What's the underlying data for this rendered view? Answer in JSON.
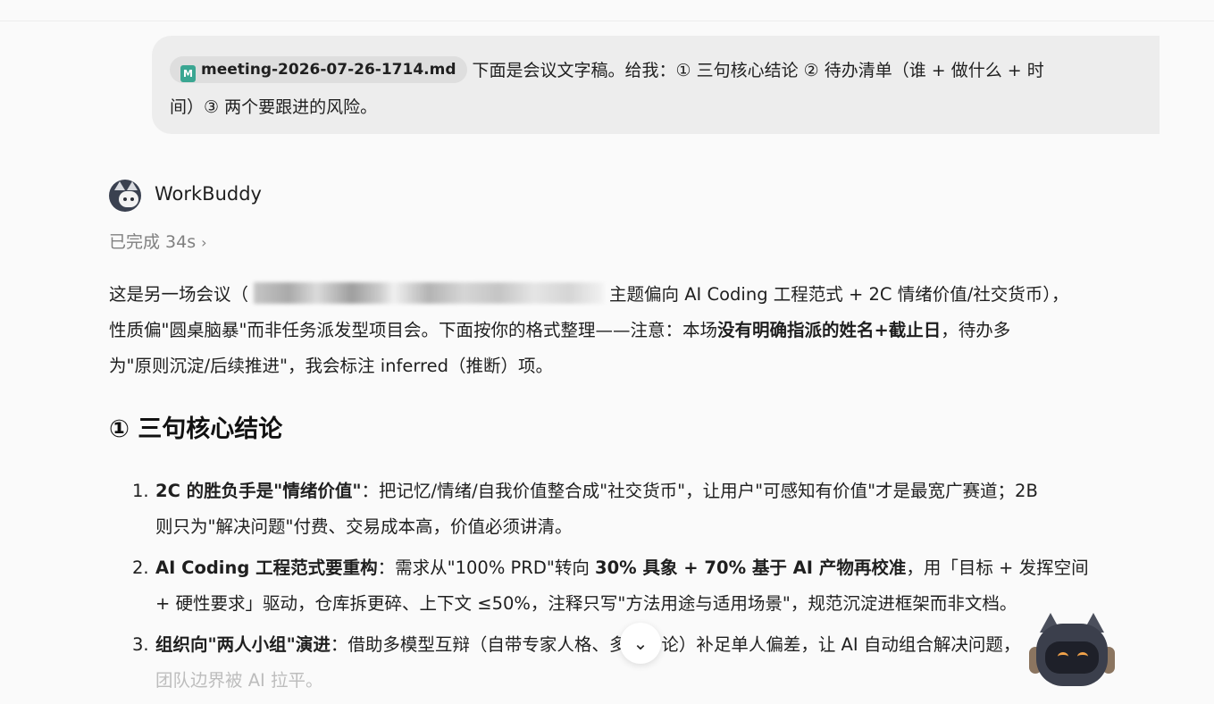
{
  "user_message": {
    "attachment_name": "meeting-2026-07-26-1714.md",
    "attachment_icon": "markdown-file-icon",
    "line1": "下面是会议文字稿。给我：① 三句核心结论 ② 待办清单（谁 + 做什么 + 时",
    "line2": "间）③ 两个要跟进的风险。"
  },
  "agent": {
    "name": "WorkBuddy",
    "status": "已完成 34s"
  },
  "intro": {
    "r1_a": "这是另一场会议（",
    "r1_b": "主题偏向 AI Coding 工程范式 + 2C 情绪价值/社交货币），",
    "r2_a": "性质偏\"圆桌脑暴\"而非任务派发型项目会。下面按你的格式整理——注意：本场",
    "r2_b": "没有明确指派的姓名+截止日",
    "r2_c": "，待办多",
    "r3": "为\"原则沉淀/后续推进\"，我会标注 inferred（推断）项。"
  },
  "section1": {
    "heading": "① 三句核心结论",
    "items": [
      {
        "num": "1.",
        "r1_b1": "2C 的胜负手是\"",
        "r1_b2": "情绪价值",
        "r1_b3": "\"",
        "r1_t": "：把记忆/情绪/自我价值整合成\"社交货币\"，让用户\"可感知有价值\"才是最宽广赛道；2B",
        "r2": "则只为\"解决问题\"付费、交易成本高，价值必须讲清。"
      },
      {
        "num": "2.",
        "r1_b1": "AI Coding 工程范式要重构",
        "r1_t1": "：需求从\"100% PRD\"转向 ",
        "r1_b2": "30% 具象 + 70% 基于 AI 产物再校准",
        "r1_t2": "，用「目标 + 发挥空间",
        "r2": "+ 硬性要求」驱动，仓库拆更碎、上下文 ≤50%，注释只写\"方法用途与适用场景\"，规范沉淀进框架而非文档。"
      },
      {
        "num": "3.",
        "r1_b1": "组织向\"两人小组\"演进",
        "r1_t": "：借助多模型互辩（自带专家人格、多轮讨论）补足单人偏差，让 AI 自动组合解决问题，",
        "r2": "团队边界被 AI 拉平。"
      }
    ]
  },
  "controls": {
    "scroll_down_icon": "chevron-down-icon",
    "scroll_down_glyph": "⌄"
  },
  "colors": {
    "bubble": "#ededed",
    "file_icon": "#3aa692",
    "muted": "#808080"
  }
}
